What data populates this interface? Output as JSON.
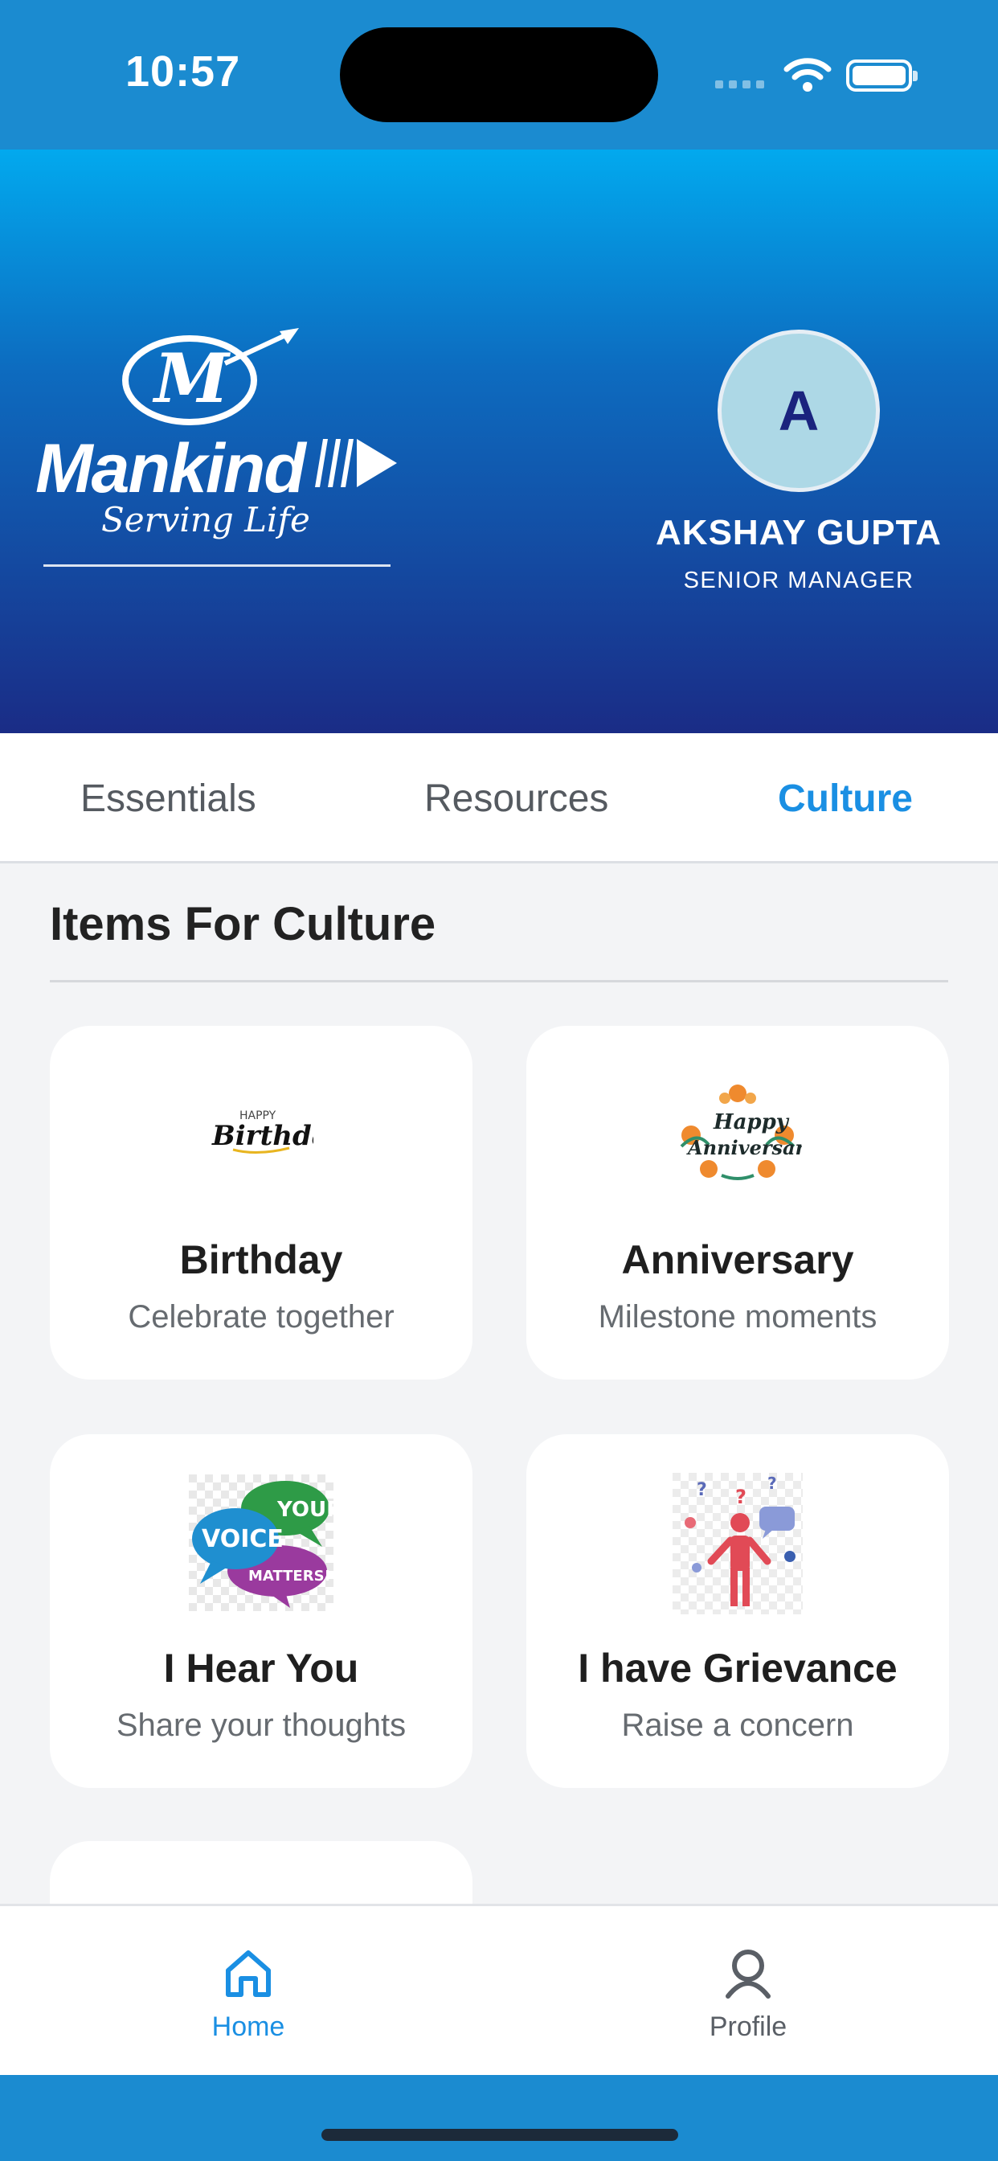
{
  "status": {
    "time": "10:57"
  },
  "header": {
    "brand": "Mankind",
    "tagline": "Serving Life",
    "user": {
      "initial": "A",
      "name": "AKSHAY GUPTA",
      "role": "SENIOR MANAGER"
    }
  },
  "tabs": [
    {
      "label": "Essentials",
      "active": false
    },
    {
      "label": "Resources",
      "active": false
    },
    {
      "label": "Culture",
      "active": true
    }
  ],
  "section": {
    "title": "Items For Culture"
  },
  "cards": [
    {
      "title": "Birthday",
      "subtitle": "Celebrate together",
      "icon": "birthday-icon",
      "icon_text": [
        "HAPPY",
        "Birthday"
      ]
    },
    {
      "title": "Anniversary",
      "subtitle": "Milestone moments",
      "icon": "anniversary-icon",
      "icon_text": [
        "Happy",
        "Anniversary"
      ]
    },
    {
      "title": "I Hear You",
      "subtitle": "Share your thoughts",
      "icon": "voice-matters-icon",
      "icon_text": [
        "YOUR",
        "VOICE",
        "MATTERS!"
      ]
    },
    {
      "title": "I have Grievance",
      "subtitle": "Raise a concern",
      "icon": "grievance-icon"
    }
  ],
  "bottom_nav": [
    {
      "label": "Home",
      "icon": "home-icon",
      "active": true
    },
    {
      "label": "Profile",
      "icon": "profile-icon",
      "active": false
    }
  ],
  "colors": {
    "accent": "#1a8fe3",
    "header_top": "#02a9ee",
    "header_bottom": "#1a2c86",
    "status_bar": "#1b8bd0"
  }
}
